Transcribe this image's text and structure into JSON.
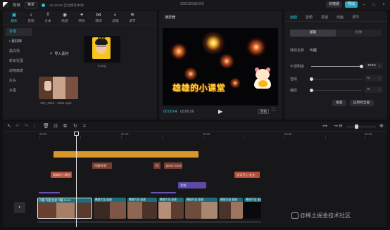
{
  "titlebar": {
    "app_name": "剪映",
    "menu_label": "菜单",
    "autosave_status": "16:45:54 自动保存本地",
    "project_title": "202102191643",
    "export_label": "导出",
    "shortcut_label": "快捷键",
    "layout_label": "布局"
  },
  "media_tabs": [
    {
      "icon": "▣",
      "label": "媒体"
    },
    {
      "icon": "♪",
      "label": "音频"
    },
    {
      "icon": "T",
      "label": "文本"
    },
    {
      "icon": "◉",
      "label": "贴纸"
    },
    {
      "icon": "✦",
      "label": "特效"
    },
    {
      "icon": "⋈",
      "label": "转场"
    },
    {
      "icon": "◐",
      "label": "滤镜"
    },
    {
      "icon": "≋",
      "label": "调节"
    }
  ],
  "subnav": [
    {
      "label": "本地"
    },
    {
      "label": "• 素材库"
    },
    {
      "label": "黑白场"
    },
    {
      "label": "新年氛围"
    },
    {
      "label": "动物萌宠"
    },
    {
      "label": "片头"
    },
    {
      "label": "片尾"
    }
  ],
  "assets": {
    "import_label": "导入素材",
    "avatar_caption": "吕教授",
    "avatar_filename": "5.png",
    "video_filename": "VID_2021...2054.mp4"
  },
  "player": {
    "title": "播放器",
    "overlay_text": "雄雄的小课堂",
    "current_time": "00:00:04",
    "total_time": "00:00:26",
    "ratio_label": "原始",
    "play_icon": "▶",
    "fullscreen_icon": "⛶"
  },
  "props": {
    "tabs": [
      "画面",
      "音频",
      "变速",
      "动画",
      "调节"
    ],
    "segment": [
      "基础",
      "抠像"
    ],
    "name_label": "特效名称",
    "name_value": "叫醒",
    "opacity_label": "不透明度",
    "opacity_value": "100%",
    "opacity_level": 1.0,
    "row2_label": "音效",
    "row2_value": "0",
    "row3_label": "缩放",
    "row3_value": "0",
    "reset_label": "重置",
    "apply_label": "应用到全部"
  },
  "timeline": {
    "ruler": [
      "00:00",
      "00:10",
      "00:20",
      "00:30",
      "00:40"
    ],
    "cover_label": "封面",
    "track_texts": {
      "t_sticker": "",
      "brown1": "叫醒讲课",
      "brown2": "叫",
      "brown3": "plane scene",
      "red1": "雄雄的小课堂",
      "red2": "说话开心 变长",
      "purple": "音频"
    },
    "clip_heads": [
      "叫醒 叫醒 变速 叫醒 00:00",
      "播放片段 变速",
      "播放片段 变速",
      "播放片段 变速",
      "播放片段 变速",
      "播放片段 变速",
      "播放片段 变速"
    ],
    "watermark": "@稀土掘金技术社区"
  }
}
